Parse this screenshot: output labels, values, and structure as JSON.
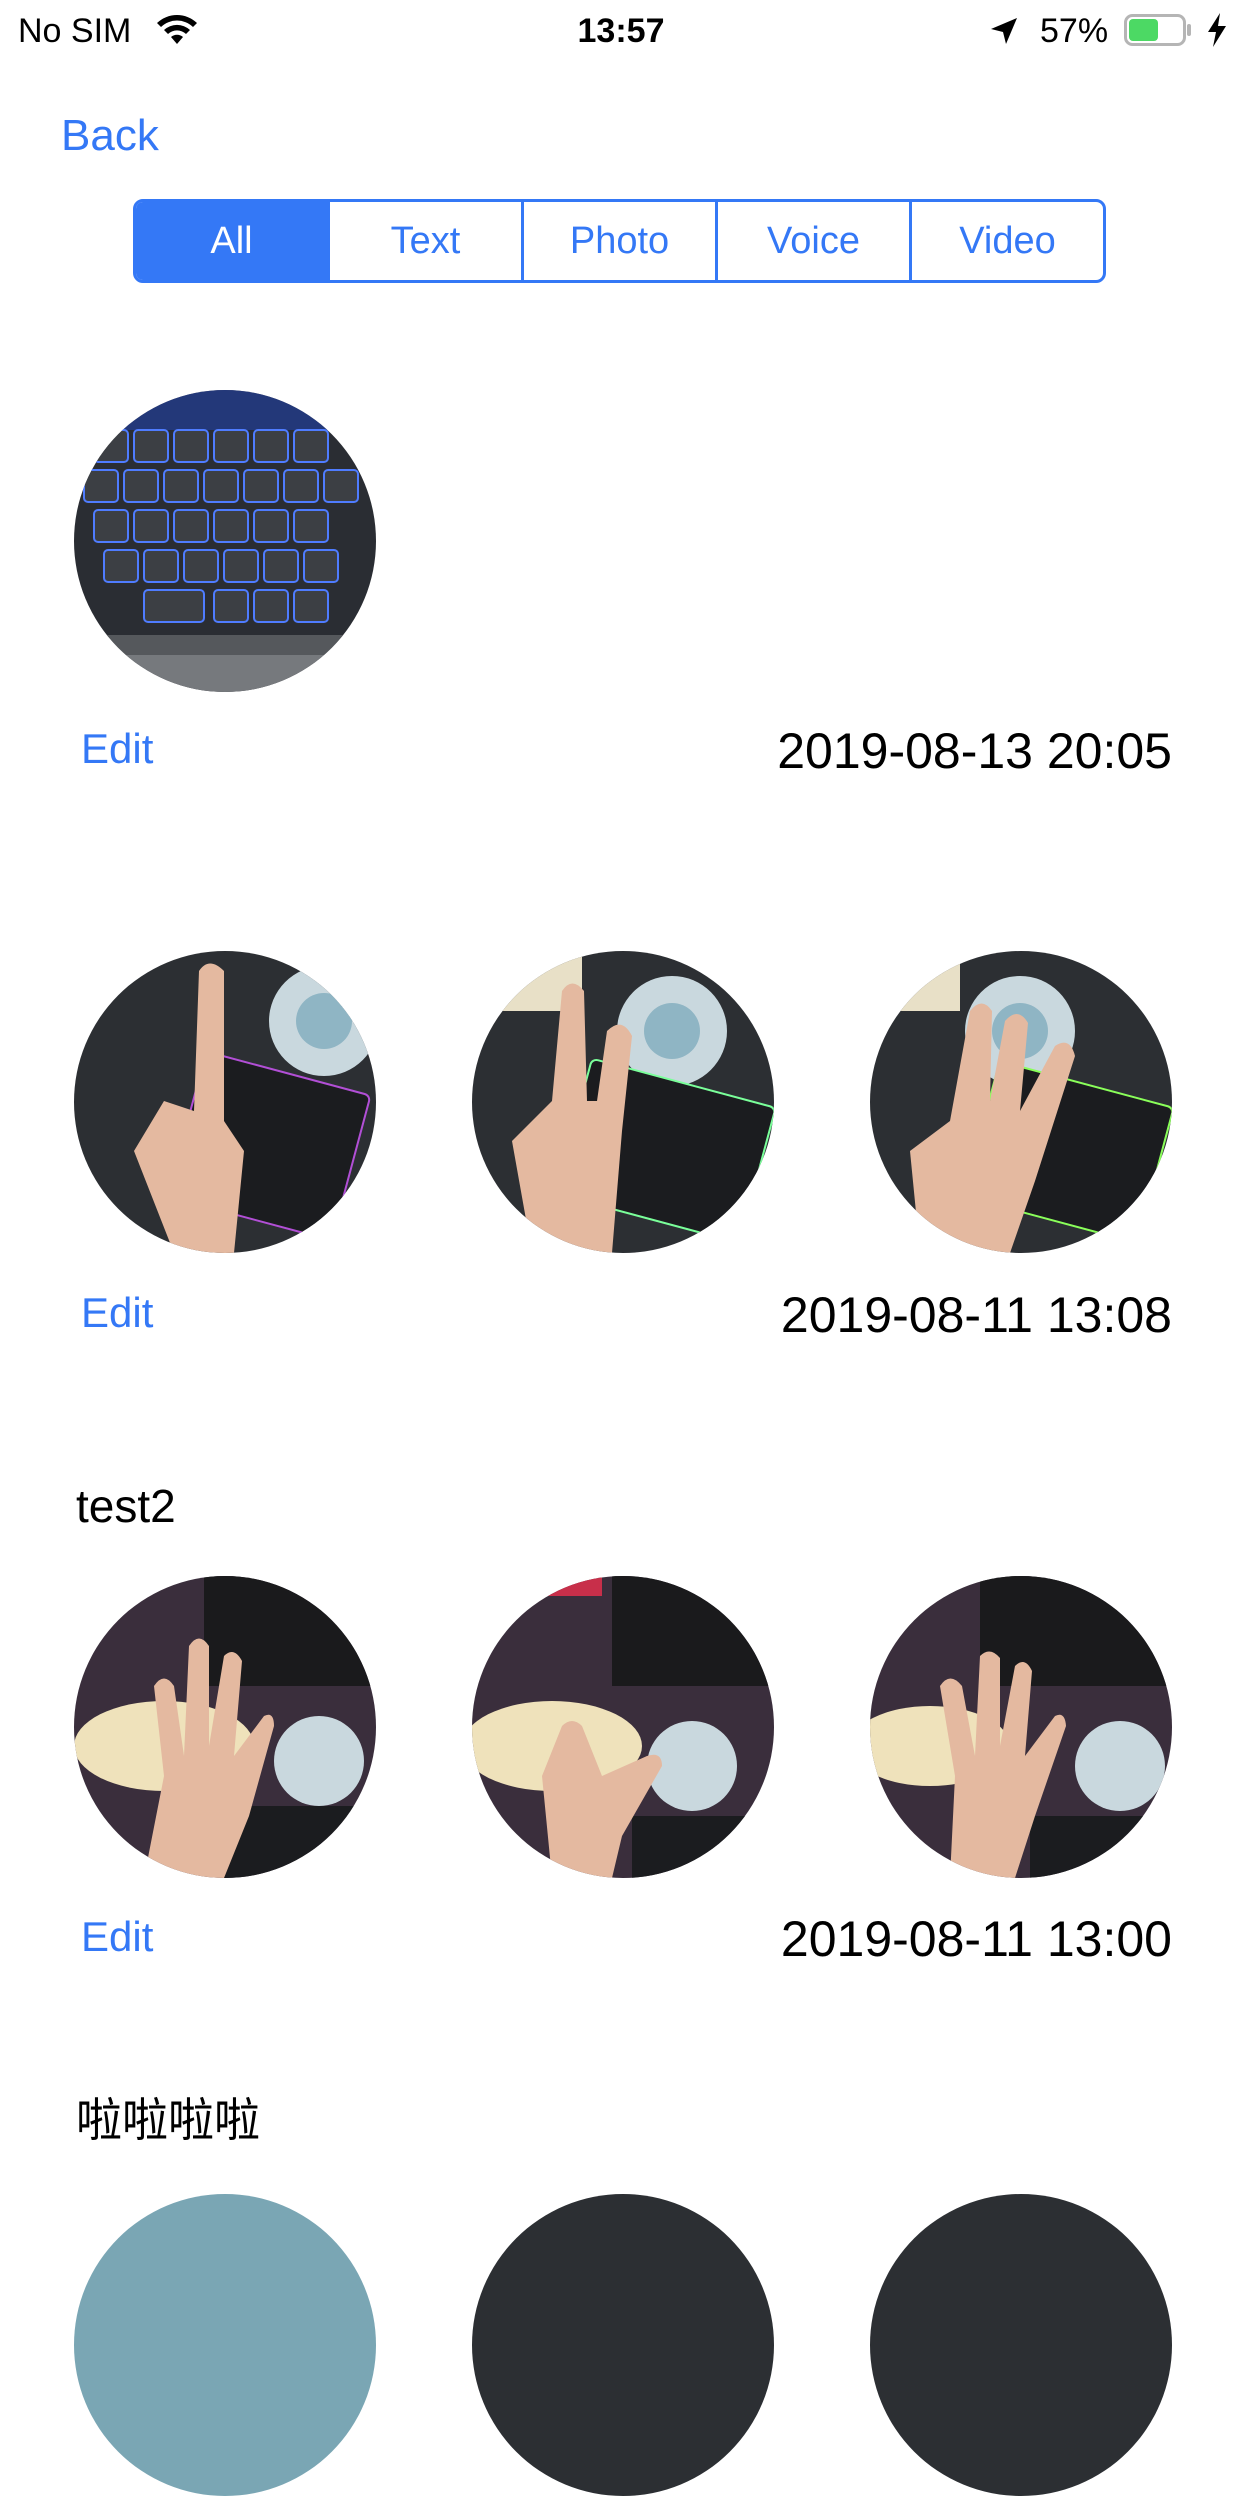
{
  "status_bar": {
    "carrier": "No SIM",
    "time": "13:57",
    "battery_percent": "57%",
    "battery_level": 0.57,
    "battery_color": "#4cd964"
  },
  "nav": {
    "back_label": "Back"
  },
  "filter": {
    "segments": [
      "All",
      "Text",
      "Photo",
      "Voice",
      "Video"
    ],
    "selected": "All",
    "accent_color": "#3478f6"
  },
  "entries": [
    {
      "text": "",
      "photos": [
        "keyboard-photo"
      ],
      "edit_label": "Edit",
      "timestamp": "2019-08-13 20:05"
    },
    {
      "text": "",
      "photos": [
        "one-finger-photo",
        "two-fingers-photo",
        "three-fingers-photo"
      ],
      "edit_label": "Edit",
      "timestamp": "2019-08-11 13:08"
    },
    {
      "text": "test2",
      "photos": [
        "open-hand-photo",
        "pointing-hand-photo",
        "spread-hand-photo"
      ],
      "edit_label": "Edit",
      "timestamp": "2019-08-11 13:00"
    },
    {
      "text": "啦啦啦啦"
    }
  ]
}
